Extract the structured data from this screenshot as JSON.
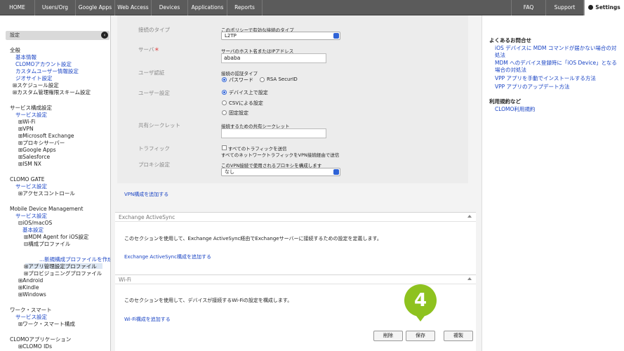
{
  "nav": {
    "items": [
      "HOME",
      "Users/Org",
      "Google Apps",
      "Web Access",
      "Devices",
      "Applications",
      "Reports"
    ],
    "faq": "FAQ",
    "support": "Support",
    "settings": "Settings"
  },
  "sidebar": {
    "header": "設定",
    "lines": [
      {
        "text": "全般",
        "type": "text"
      },
      {
        "text": "基本情報",
        "type": "link"
      },
      {
        "text": "CLOMOアカウント設定",
        "type": "link"
      },
      {
        "text": "カスタムユーザー情報設定",
        "type": "link"
      },
      {
        "text": "ジオサイト設定",
        "type": "link"
      },
      {
        "text": "⊞スケジュール設定",
        "type": "text"
      },
      {
        "text": "⊞カスタム管理権限スキーム設定",
        "type": "text"
      },
      {
        "text": "サービス構成設定",
        "type": "text"
      },
      {
        "text": "サービス設定",
        "type": "link"
      },
      {
        "text": "⊞Wi-Fi",
        "type": "text"
      },
      {
        "text": "⊞VPN",
        "type": "text"
      },
      {
        "text": "⊞Microsoft Exchange",
        "type": "text"
      },
      {
        "text": "⊞プロキシサーバー",
        "type": "text"
      },
      {
        "text": "⊞Google Apps",
        "type": "text"
      },
      {
        "text": "⊞Salesforce",
        "type": "text"
      },
      {
        "text": "⊞ISM NX",
        "type": "text"
      },
      {
        "text": "CLOMO GATE",
        "type": "text"
      },
      {
        "text": "サービス設定",
        "type": "link"
      },
      {
        "text": "⊞アクセスコントロール",
        "type": "text"
      },
      {
        "text": "Mobile Device Management",
        "type": "text"
      },
      {
        "text": "サービス設定",
        "type": "link"
      },
      {
        "text": "⊟iOS/macOS",
        "type": "text"
      },
      {
        "text": "基本設定",
        "type": "link"
      },
      {
        "text": "⊞MDM Agent for iOS設定",
        "type": "text"
      },
      {
        "text": "⊟構成プロファイル",
        "type": "text"
      },
      {
        "text": "...新規構成プロファイルを作成",
        "type": "link"
      },
      {
        "text": "⊞アプリ管理設定プロファイル",
        "type": "text"
      },
      {
        "text": "⊞プロビジョニングプロファイル",
        "type": "text"
      },
      {
        "text": "⊞Android",
        "type": "text"
      },
      {
        "text": "⊞Kindle",
        "type": "text"
      },
      {
        "text": "⊞Windows",
        "type": "text"
      },
      {
        "text": "ワーク・スマート",
        "type": "text"
      },
      {
        "text": "サービス設定",
        "type": "link"
      },
      {
        "text": "⊞ワーク・スマート構成",
        "type": "text"
      },
      {
        "text": "CLOMOアプリケーション",
        "type": "text"
      },
      {
        "text": "⊞CLOMO IDs",
        "type": "text"
      }
    ]
  },
  "vpn": {
    "connection_type_label": "接続のタイプ",
    "connection_type_desc": "このポリシーで有効な接続のタイプ",
    "connection_type_value": "L2TP",
    "server_label": "サーバ",
    "server_required": "＊",
    "server_desc": "サーバのホスト名またはIPアドレス",
    "server_value": "ababa",
    "user_auth_label": "ユーザ認証",
    "user_auth_desc": "接続の認証タイプ",
    "user_auth_password": "パスワード",
    "user_auth_rsa": "RSA SecurID",
    "user_settings_label": "ユーザー設定",
    "user_settings_options": [
      "デバイス上で設定",
      "CSVによる設定",
      "固定設定"
    ],
    "shared_secret_label": "共有シークレット",
    "shared_secret_desc": "接続するための共有シークレット",
    "shared_secret_value": "",
    "traffic_label": "トラフィック",
    "traffic_checkbox": "すべてのトラフィックを送信",
    "traffic_desc": "すべてのネットワークトラフィックをVPN接続経由で送信",
    "proxy_label": "プロキシ設定",
    "proxy_desc": "このVPN接続で使用されるプロキシを構成します",
    "proxy_value": "なし",
    "add_link": "VPN構成を追加する"
  },
  "exchange": {
    "title": "Exchange ActiveSync",
    "desc": "このセクションを使用して、Exchange ActiveSync経由でExchangeサーバーに接続するための設定を定義します。",
    "add_link": "Exchange ActiveSync構成を追加する"
  },
  "wifi": {
    "title": "Wi-Fi",
    "desc": "このセクションを使用して、デバイスが接続するWi-Fiの設定を構成します。",
    "add_link": "Wi-Fi構成を追加する"
  },
  "buttons": {
    "delete": "削除",
    "save": "保存",
    "duplicate": "複製"
  },
  "step_badge": "4",
  "right_panel": {
    "faq_heading": "よくあるお問合せ",
    "faq_links": [
      "iOS デバイスに MDM コマンドが届かない場合の対処法",
      "MDM へのデバイス登録時に「iOS Device」となる場合の対処法",
      "VPP アプリを手動でインストールする方法",
      "VPP アプリのアップデート方法"
    ],
    "terms_heading": "利用規約など",
    "terms_link": "CLOMO利用規約"
  },
  "colors": {
    "nav_bg": "#5b5b5b",
    "link": "#1a44c4",
    "badge": "#8ec21f",
    "select_accent": "#2f63d6"
  }
}
